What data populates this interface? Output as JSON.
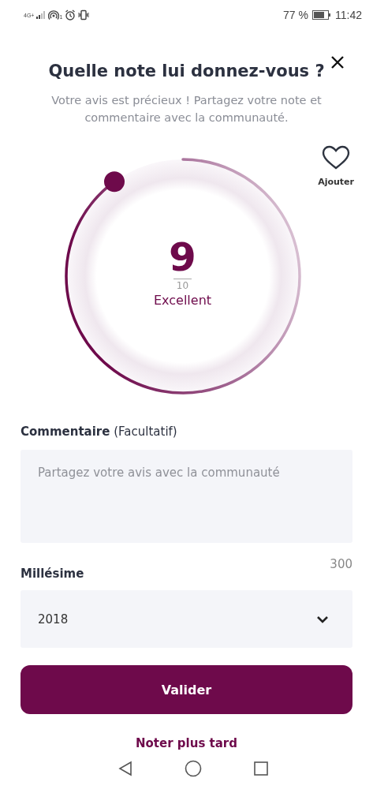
{
  "status_bar": {
    "network": "4G+",
    "hotspot_count": "1",
    "battery": "77 %",
    "time": "11:42"
  },
  "title": "Quelle note lui donnez-vous ?",
  "subtitle": "Votre avis est précieux ! Partagez votre note et commentaire avec la communauté.",
  "favorite": {
    "label": "Ajouter",
    "selected": false
  },
  "rating": {
    "score": "9",
    "max": "10",
    "verdict": "Excellent"
  },
  "comment": {
    "label": "**Commentaire** (Facultatif)",
    "placeholder": "Partagez votre avis avec la communauté",
    "counter": "300"
  },
  "vintage": {
    "label": "Millésime",
    "value": "2018"
  },
  "submit": "Valider",
  "later": "Noter plus tard"
}
